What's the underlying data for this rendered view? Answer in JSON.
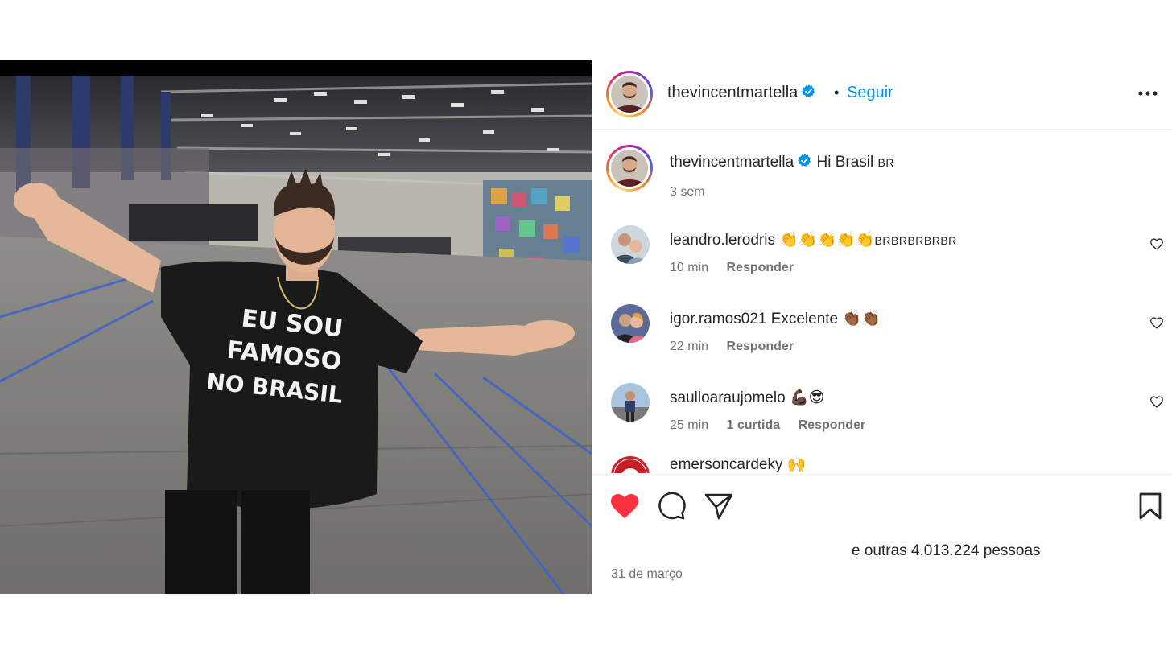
{
  "post": {
    "author": "thevincentmartella",
    "follow_label": "Seguir",
    "separator": "•"
  },
  "caption": {
    "username": "thevincentmartella",
    "text": "Hi Brasil",
    "flag_text": "BR",
    "time": "3 sem"
  },
  "comments": [
    {
      "username": "leandro.lerodris",
      "text": "👏👏👏👏👏",
      "suffix": "BRBRBRBRBR",
      "time": "10 min",
      "likes": "",
      "reply_label": "Responder"
    },
    {
      "username": "igor.ramos021",
      "text": "Excelente 👏🏾👏🏾",
      "suffix": "",
      "time": "22 min",
      "likes": "",
      "reply_label": "Responder"
    },
    {
      "username": "saulloaraujomelo",
      "text": "💪🏿😎",
      "suffix": "",
      "time": "25 min",
      "likes": "1 curtida",
      "reply_label": "Responder"
    },
    {
      "username": "emersoncardeky",
      "text": "🙌",
      "suffix": "",
      "time": "",
      "likes": "",
      "reply_label": ""
    }
  ],
  "likes_summary": {
    "prefix": "e ",
    "count_text": "outras 4.013.224 pessoas"
  },
  "date": "31 de março",
  "photo": {
    "shirt_lines": [
      "EU SOU",
      "FAMOSO",
      "NO BRASIL"
    ]
  },
  "icons": {
    "verified": "verified-badge-icon",
    "more": "more-options-icon",
    "like": "heart-filled-icon",
    "comment": "comment-bubble-icon",
    "share": "paper-plane-icon",
    "save": "bookmark-icon"
  },
  "colors": {
    "accent": "#0095f6",
    "like_red": "#ff3040",
    "text": "#262626",
    "muted": "#737373"
  }
}
